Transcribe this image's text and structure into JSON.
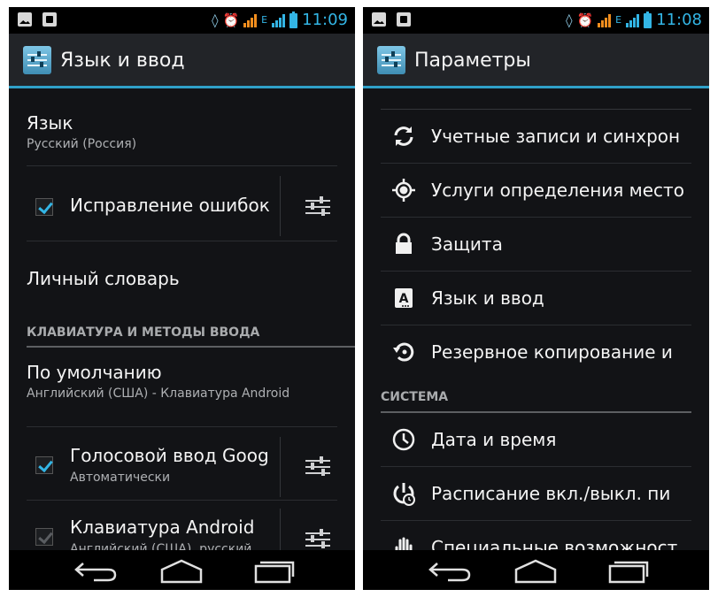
{
  "left": {
    "status": {
      "time": "11:09",
      "net": "E"
    },
    "title": "Язык и ввод",
    "language": {
      "title": "Язык",
      "value": "Русский (Россия)"
    },
    "spellcheck": {
      "label": "Исправление ошибок",
      "checked": true
    },
    "dictionary": {
      "label": "Личный словарь"
    },
    "section_keyboard": "КЛАВИАТУРА И МЕТОДЫ ВВОДА",
    "default": {
      "title": "По умолчанию",
      "value": "Английский (США) - Клавиатура Android"
    },
    "voice": {
      "title": "Голосовой ввод Goog",
      "subtitle": "Автоматически",
      "checked": true
    },
    "android_kb": {
      "title": "Клавиатура Android",
      "subtitle": "Английский (США), русский",
      "checked": true,
      "enabled": false
    }
  },
  "right": {
    "status": {
      "time": "11:08",
      "net": "E"
    },
    "title": "Параметры",
    "items": [
      {
        "label": "Учетные записи и синхрон",
        "icon": "sync-icon"
      },
      {
        "label": "Услуги определения место",
        "icon": "location-icon"
      },
      {
        "label": "Защита",
        "icon": "lock-icon"
      },
      {
        "label": "Язык и ввод",
        "icon": "language-input-icon"
      },
      {
        "label": "Резервное копирование и",
        "icon": "backup-restore-icon"
      }
    ],
    "section_system": "СИСТЕМА",
    "system_items": [
      {
        "label": "Дата и время",
        "icon": "clock-icon"
      },
      {
        "label": "Расписание вкл./выкл. пи",
        "icon": "power-schedule-icon"
      },
      {
        "label": "Специальные возможност",
        "icon": "accessibility-hand-icon"
      }
    ]
  },
  "colors": {
    "accent": "#33b5e5",
    "background": "#121316",
    "actionbar": "#222428",
    "signal": "#f28e1e"
  }
}
